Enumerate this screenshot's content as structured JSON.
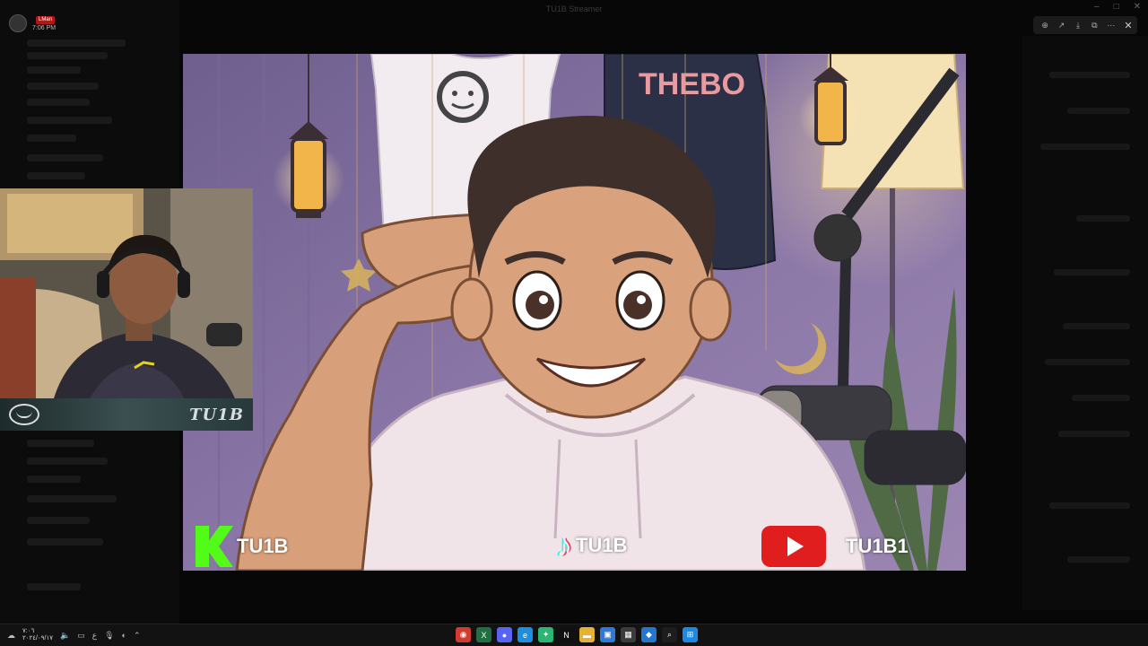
{
  "background_app": {
    "title": "TU1B Streamer",
    "user_time": "7:06 PM",
    "user_badge": "LMan"
  },
  "viewer": {
    "toolbar_icons": [
      "zoom-in-icon",
      "share-icon",
      "download-icon",
      "open-external-icon",
      "more-icon"
    ],
    "toolbar_glyphs": [
      "⊕",
      "↗",
      "⤓",
      "⧉",
      "⋯"
    ],
    "close_glyph": "✕"
  },
  "artwork": {
    "shirt_text": "THEBO",
    "social": {
      "kick_handle": "TU1B",
      "tiktok_handle": "TU1B",
      "youtube_handle": "TU1B1"
    }
  },
  "webcam": {
    "banner_text": "TU1B"
  },
  "taskbar": {
    "clock_time": "٧:٠٦",
    "clock_date": "٢٠٢٤/٠٩/١٧",
    "language": "ع",
    "apps": [
      {
        "name": "browser-chrome-icon",
        "color": "#d23b2f",
        "glyph": "◉"
      },
      {
        "name": "excel-icon",
        "color": "#1f6f43",
        "glyph": "X"
      },
      {
        "name": "discord-icon",
        "color": "#5865f2",
        "glyph": "●"
      },
      {
        "name": "edge-icon",
        "color": "#1d8fe0",
        "glyph": "e"
      },
      {
        "name": "copilot-icon",
        "color": "#2bb673",
        "glyph": "✦"
      },
      {
        "name": "netflix-icon",
        "color": "#111111",
        "glyph": "N"
      },
      {
        "name": "file-explorer-icon",
        "color": "#e4b333",
        "glyph": "▬"
      },
      {
        "name": "photos-icon",
        "color": "#2f7ad6",
        "glyph": "▣"
      },
      {
        "name": "store-icon",
        "color": "#3b3b3b",
        "glyph": "▦"
      },
      {
        "name": "vscode-icon",
        "color": "#2478cc",
        "glyph": "◆"
      },
      {
        "name": "search-icon",
        "color": "#1d1d1d",
        "glyph": "⌕"
      },
      {
        "name": "windows-start-icon",
        "color": "#1e88e5",
        "glyph": "⊞"
      }
    ]
  }
}
